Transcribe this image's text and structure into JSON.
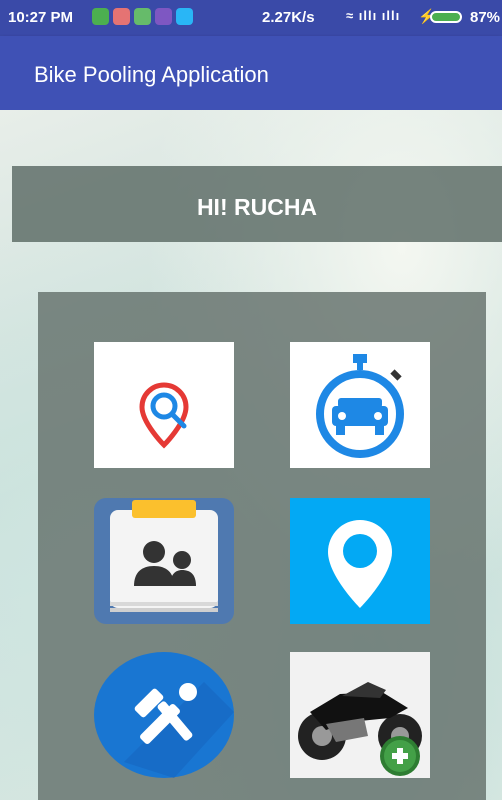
{
  "status_bar": {
    "time": "10:27 PM",
    "speed": "2.27K/s",
    "battery": "87%"
  },
  "app_bar": {
    "title": "Bike Pooling Application"
  },
  "greeting": {
    "text": "HI! RUCHA"
  },
  "menu": {
    "items": [
      {
        "icon": "search-location-icon"
      },
      {
        "icon": "taxi-timer-icon"
      },
      {
        "icon": "contacts-icon"
      },
      {
        "icon": "map-pin-icon"
      },
      {
        "icon": "tools-icon"
      },
      {
        "icon": "add-bike-icon"
      }
    ]
  },
  "colors": {
    "app_bar": "#3f51b5",
    "status_bar": "#3a4aa8",
    "pin_tile": "#03a9f4"
  }
}
